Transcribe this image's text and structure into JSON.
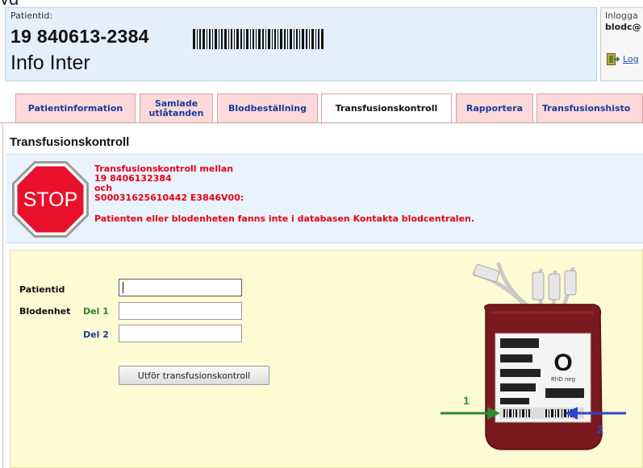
{
  "header": {
    "patient_label": "Patientid:",
    "patient_number": "19 840613-2384",
    "patient_name": "Info Inter"
  },
  "login": {
    "label": "Inlogga",
    "user": "blodc@",
    "logout_label": "Log"
  },
  "tabs": [
    {
      "label": "Patientinformation",
      "active": false
    },
    {
      "label_line1": "Samlade",
      "label_line2": "utlåtanden",
      "active": false
    },
    {
      "label": "Blodbeställning",
      "active": false
    },
    {
      "label": "Transfusionskontroll",
      "active": true
    },
    {
      "label": "Rapportera",
      "active": false
    },
    {
      "label": "Transfusionshisto",
      "active": false
    }
  ],
  "section": {
    "title": "Transfusionskontroll"
  },
  "alert": {
    "stop_text": "STOP",
    "line1": "Transfusionskontroll mellan",
    "line2": "19 8406132384",
    "line3": "och",
    "line4": "S00031625610442 E3846V00:",
    "line5": "Patienten eller blodenheten fanns inte i databasen Kontakta blodcentralen."
  },
  "form": {
    "patientid_label": "Patientid",
    "patientid_value": "",
    "blodenhet_label": "Blodenhet",
    "del1_label": "Del 1",
    "del1_value": "",
    "del2_label": "Del 2",
    "del2_value": "",
    "submit_label": "Utför transfusionskontroll"
  },
  "illustration": {
    "blood_group": "O",
    "rh": "RhD neg",
    "arrow1_label": "1",
    "arrow2_label": "2"
  },
  "colors": {
    "tab_bg": "#fdd9d9",
    "alert_text": "#e3001b",
    "form_bg": "#fdfbd3",
    "arrow1": "#2e8b2e",
    "arrow2": "#2e46c8"
  }
}
